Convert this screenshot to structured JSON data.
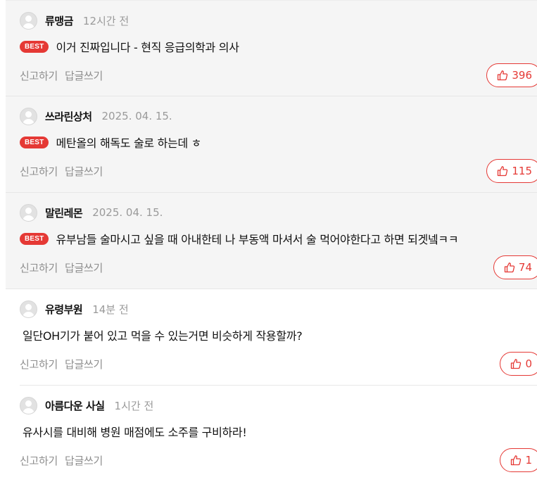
{
  "comments": [
    {
      "author": "류맹금",
      "time": "12시간 전",
      "best": true,
      "badge": "BEST",
      "text": "이거 진짜입니다 - 현직 응급의학과 의사",
      "report": "신고하기",
      "reply": "답글쓰기",
      "likes": "396"
    },
    {
      "author": "쓰라린상처",
      "time": "2025. 04. 15.",
      "best": true,
      "badge": "BEST",
      "text": "메탄올의 해독도 술로 하는데 ㅎ",
      "report": "신고하기",
      "reply": "답글쓰기",
      "likes": "115"
    },
    {
      "author": "말린레몬",
      "time": "2025. 04. 15.",
      "best": true,
      "badge": "BEST",
      "text": "유부남들 술마시고 싶을 때 아내한테 나 부동액 마셔서 술 먹어야한다고 하면 되겟넼ㅋㅋ",
      "report": "신고하기",
      "reply": "답글쓰기",
      "likes": "74"
    },
    {
      "author": "유령부원",
      "time": "14분 전",
      "best": false,
      "text": "일단OH기가 붙어 있고 먹을 수 있는거면 비슷하게 작용할까?",
      "report": "신고하기",
      "reply": "답글쓰기",
      "likes": "0"
    },
    {
      "author": "아름다운 사실",
      "time": "1시간 전",
      "best": false,
      "text": "유사시를 대비해 병원 매점에도 소주를 구비하라!",
      "report": "신고하기",
      "reply": "답글쓰기",
      "likes": "1"
    }
  ],
  "icons": {
    "avatar": "default-user-avatar",
    "like": "thumbs-up-icon"
  },
  "colors": {
    "accent": "#e53935",
    "best_bg": "#f5f5f5",
    "muted": "#9a9a9a"
  }
}
